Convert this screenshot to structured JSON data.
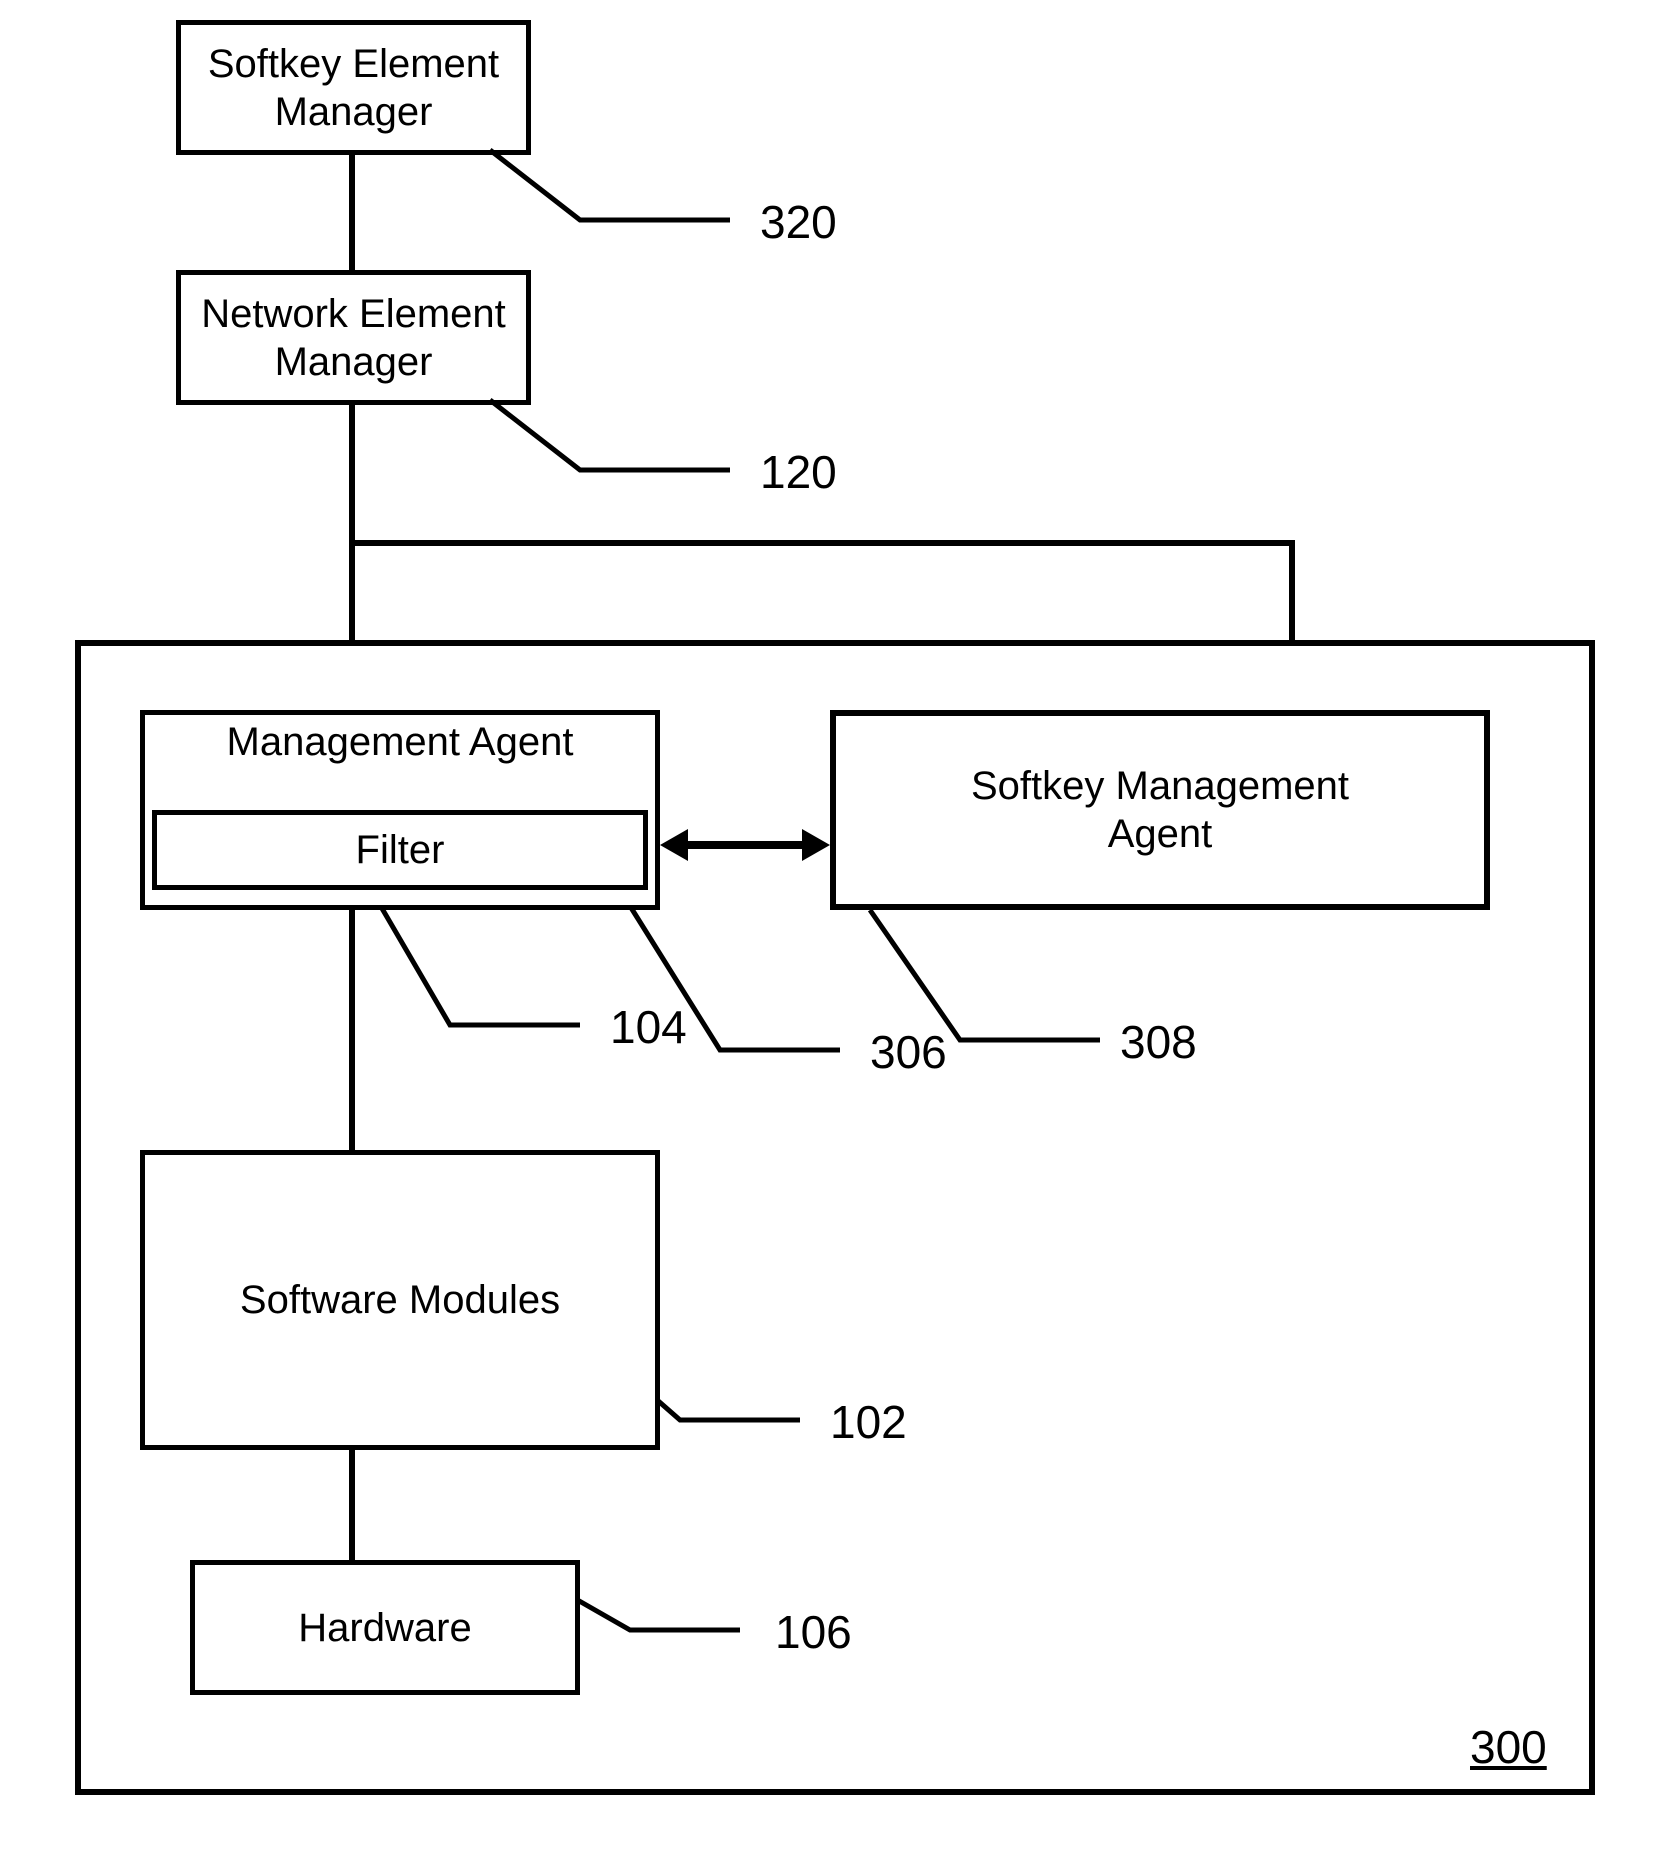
{
  "boxes": {
    "softkey_element_manager": "Softkey Element\nManager",
    "network_element_manager": "Network Element\nManager",
    "management_agent": "Management Agent",
    "filter": "Filter",
    "softkey_management_agent": "Softkey Management\nAgent",
    "software_modules": "Software Modules",
    "hardware": "Hardware"
  },
  "labels": {
    "l320": "320",
    "l120": "120",
    "l104": "104",
    "l306": "306",
    "l308": "308",
    "l102": "102",
    "l106": "106",
    "l300": "300"
  }
}
